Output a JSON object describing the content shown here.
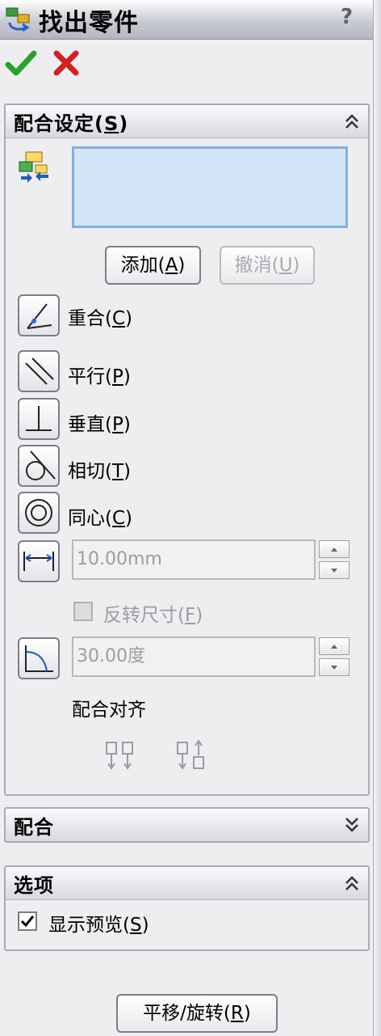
{
  "header": {
    "title": "找出零件",
    "help": "?"
  },
  "actions": {
    "ok": "ok",
    "cancel": "cancel"
  },
  "mate_settings": {
    "title_text": "配合设定(",
    "title_key": "S",
    "title_end": ")",
    "add_btn": {
      "text": "添加(",
      "key": "A",
      "end": ")"
    },
    "undo_btn": {
      "text": "撤消(",
      "key": "U",
      "end": ")"
    },
    "types": [
      {
        "label": "重合(",
        "key": "C",
        "end": ")",
        "icon": "coincident-icon"
      },
      {
        "label": "平行(",
        "key": "P",
        "end": ")",
        "icon": "parallel-icon"
      },
      {
        "label": "垂直(",
        "key": "P",
        "end": ")",
        "icon": "perpendicular-icon"
      },
      {
        "label": "相切(",
        "key": "T",
        "end": ")",
        "icon": "tangent-icon"
      },
      {
        "label": "同心(",
        "key": "C",
        "end": ")",
        "icon": "concentric-icon"
      }
    ],
    "distance": "10.00mm",
    "flip": {
      "text": "反转尺寸(",
      "key": "F",
      "end": ")",
      "checked": false
    },
    "angle": "30.00度",
    "alignment_label": "配合对齐"
  },
  "mates": {
    "title": "配合"
  },
  "options": {
    "title": "选项",
    "show_preview": {
      "text": "显示预览(",
      "key": "S",
      "end": ")",
      "checked": true
    }
  },
  "pan_rotate": {
    "text": "平移/旋转(",
    "key": "R",
    "end": ")"
  },
  "colors": {
    "selection_box": "#d3e6f8",
    "accent_border": "#7fb1e4"
  }
}
